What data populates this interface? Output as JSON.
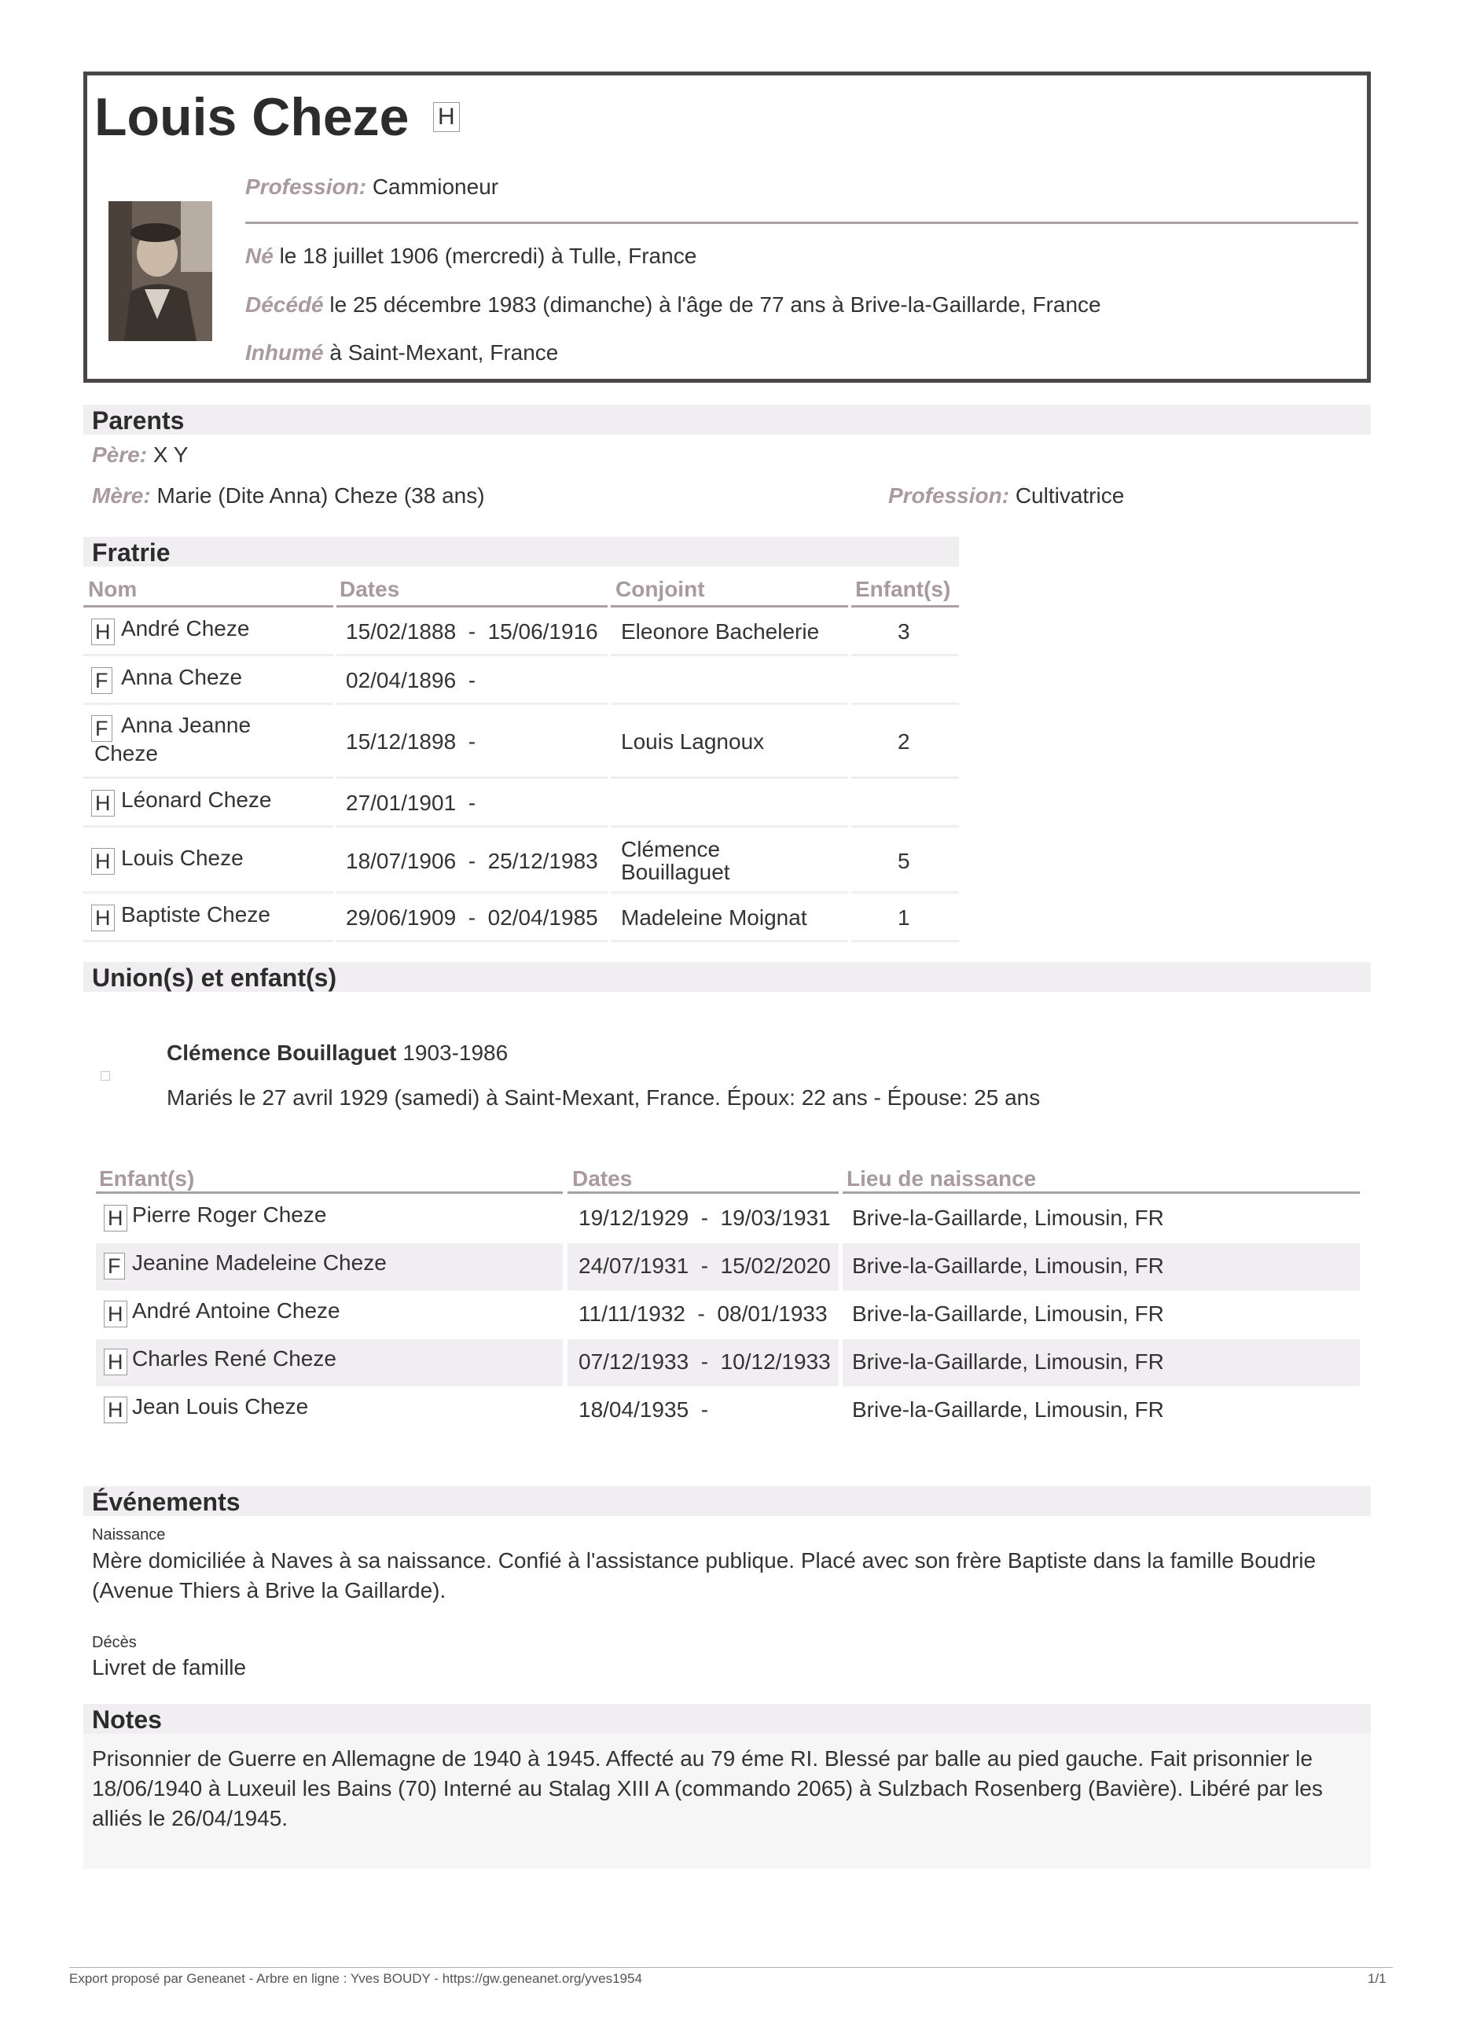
{
  "person": {
    "name": "Louis Cheze",
    "sex": "H",
    "profession_label": "Profession:",
    "profession": "Cammioneur",
    "birth_label": "Né",
    "birth_text": "le 18 juillet 1906 (mercredi) à Tulle, France",
    "death_label": "Décédé",
    "death_text": "le 25 décembre 1983 (dimanche) à l'âge de 77 ans à Brive-la-Gaillarde, France",
    "burial_label": "Inhumé",
    "burial_text": "à Saint-Mexant, France"
  },
  "parents": {
    "title": "Parents",
    "father_label": "Père:",
    "father": "X Y",
    "mother_label": "Mère:",
    "mother": "Marie (Dite Anna) Cheze (38 ans)",
    "mother_profession_label": "Profession:",
    "mother_profession": "Cultivatrice"
  },
  "fratrie": {
    "title": "Fratrie",
    "headers": [
      "Nom",
      "Dates",
      "Conjoint",
      "Enfant(s)"
    ],
    "rows": [
      {
        "sex": "H",
        "name": "André Cheze",
        "dates": "15/02/1888  -  15/06/1916",
        "spouse": "Eleonore Bachelerie",
        "children": "3"
      },
      {
        "sex": "F",
        "name": "Anna Cheze",
        "dates": "02/04/1896  -",
        "spouse": "",
        "children": ""
      },
      {
        "sex": "F",
        "name": "Anna Jeanne",
        "name2": "Cheze",
        "dates": "15/12/1898  -",
        "spouse": "Louis Lagnoux",
        "children": "2"
      },
      {
        "sex": "H",
        "name": "Léonard Cheze",
        "dates": "27/01/1901  -",
        "spouse": "",
        "children": ""
      },
      {
        "sex": "H",
        "name": "Louis Cheze",
        "dates": "18/07/1906  -  25/12/1983",
        "spouse": "Clémence",
        "spouse2": "Bouillaguet",
        "children": "5"
      },
      {
        "sex": "H",
        "name": "Baptiste Cheze",
        "dates": "29/06/1909  -  02/04/1985",
        "spouse": "Madeleine Moignat",
        "children": "1"
      }
    ]
  },
  "unions": {
    "title": "Union(s) et enfant(s)",
    "spouse_name": "Clémence Bouillaguet",
    "spouse_years": "1903-1986",
    "marriage_text": "Mariés le 27 avril 1929 (samedi) à Saint-Mexant, France. Époux: 22 ans - Épouse: 25 ans",
    "children_headers": [
      "Enfant(s)",
      "Dates",
      "Lieu de naissance"
    ],
    "children": [
      {
        "sex": "H",
        "name": "Pierre Roger Cheze",
        "dates": "19/12/1929  -  19/03/1931",
        "place": "Brive-la-Gaillarde, Limousin, FR"
      },
      {
        "sex": "F",
        "name": "Jeanine Madeleine Cheze",
        "dates": "24/07/1931  -  15/02/2020",
        "place": "Brive-la-Gaillarde, Limousin, FR"
      },
      {
        "sex": "H",
        "name": "André Antoine Cheze",
        "dates": "11/11/1932  -  08/01/1933",
        "place": "Brive-la-Gaillarde, Limousin, FR"
      },
      {
        "sex": "H",
        "name": "Charles René Cheze",
        "dates": "07/12/1933  -  10/12/1933",
        "place": "Brive-la-Gaillarde, Limousin, FR"
      },
      {
        "sex": "H",
        "name": "Jean Louis Cheze",
        "dates": "18/04/1935  -",
        "place": "Brive-la-Gaillarde, Limousin, FR"
      }
    ]
  },
  "events": {
    "title": "Événements",
    "items": [
      {
        "label": "Naissance",
        "line1": "Mère domiciliée à Naves à sa naissance. Confié à l'assistance publique. Placé avec son frère Baptiste dans la famille Boudrie",
        "line2": "(Avenue Thiers à Brive la Gaillarde)."
      },
      {
        "label": "Décès",
        "line1": "Livret de famille"
      }
    ]
  },
  "notes": {
    "title": "Notes",
    "line1": "Prisonnier de Guerre en Allemagne de 1940 à 1945. Affecté au 79 éme RI. Blessé par balle au pied gauche. Fait prisonnier le",
    "line2": "18/06/1940 à Luxeuil les Bains (70) Interné au Stalag XIII A (commando 2065) à Sulzbach Rosenberg (Bavière). Libéré par les",
    "line3": "alliés le 26/04/1945."
  },
  "footer": {
    "left": "Export proposé par Geneanet - Arbre en ligne : Yves BOUDY - https://gw.geneanet.org/yves1954",
    "right": "1/1"
  },
  "colors": {
    "label": "#a99aa0",
    "bar": "#f0eef0",
    "border": "#4a4648"
  }
}
